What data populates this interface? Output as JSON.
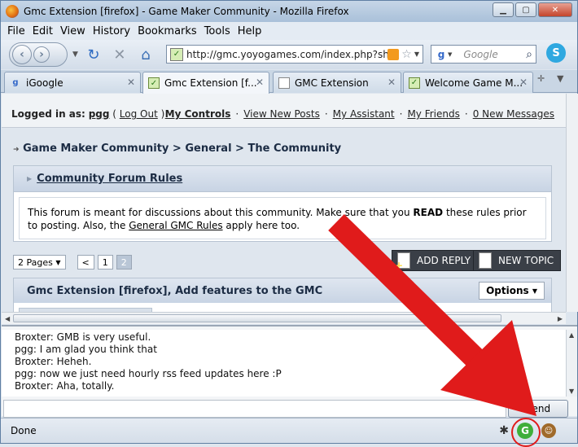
{
  "window": {
    "title": "Gmc Extension [firefox] - Game Maker Community - Mozilla Firefox"
  },
  "menu": [
    "File",
    "Edit",
    "View",
    "History",
    "Bookmarks",
    "Tools",
    "Help"
  ],
  "address": {
    "url": "http://gmc.yoyogames.com/index.php?sh",
    "search_placeholder": "Google"
  },
  "tabs": [
    {
      "label": "iGoogle",
      "icon": "google-icon"
    },
    {
      "label": "Gmc Extension [f...",
      "icon": "gmc-icon",
      "active": true
    },
    {
      "label": "GMC Extension",
      "icon": "page-icon"
    },
    {
      "label": "Welcome Game M...",
      "icon": "gmc-icon"
    }
  ],
  "userbar": {
    "logged_prefix": "Logged in as:",
    "username": "pgg",
    "logout": "Log Out",
    "links": [
      "My Controls",
      "View New Posts",
      "My Assistant",
      "My Friends",
      "0 New Messages"
    ]
  },
  "breadcrumb": "Game Maker Community > General > The Community",
  "rules": {
    "title": "Community Forum Rules",
    "text_1": "This forum is meant for discussions about this community. Make sure that you",
    "text_bold": "READ",
    "text_2": "these rules prior to posting. Also, the",
    "link": "General GMC Rules",
    "text_3": "apply here too."
  },
  "pager": {
    "pages_label": "2 Pages",
    "prev": "<",
    "page1": "1",
    "page2": "2"
  },
  "buttons": {
    "add_reply": "ADD REPLY",
    "new_topic": "NEW TOPIC",
    "options": "Options"
  },
  "topic_title": "Gmc Extension [firefox], Add features to the GMC",
  "chat": {
    "lines": [
      "Broxter: GMB is very useful.",
      "pgg: I am glad you think that",
      "Broxter: Heheh.",
      "pgg: now we just need hourly rss feed updates here :P",
      "Broxter: Aha, totally."
    ],
    "send_label": "Send"
  },
  "status": {
    "text": "Done"
  },
  "colors": {
    "annotation_arrow": "#e01b1b",
    "window_frame": "#a9c0d9"
  }
}
